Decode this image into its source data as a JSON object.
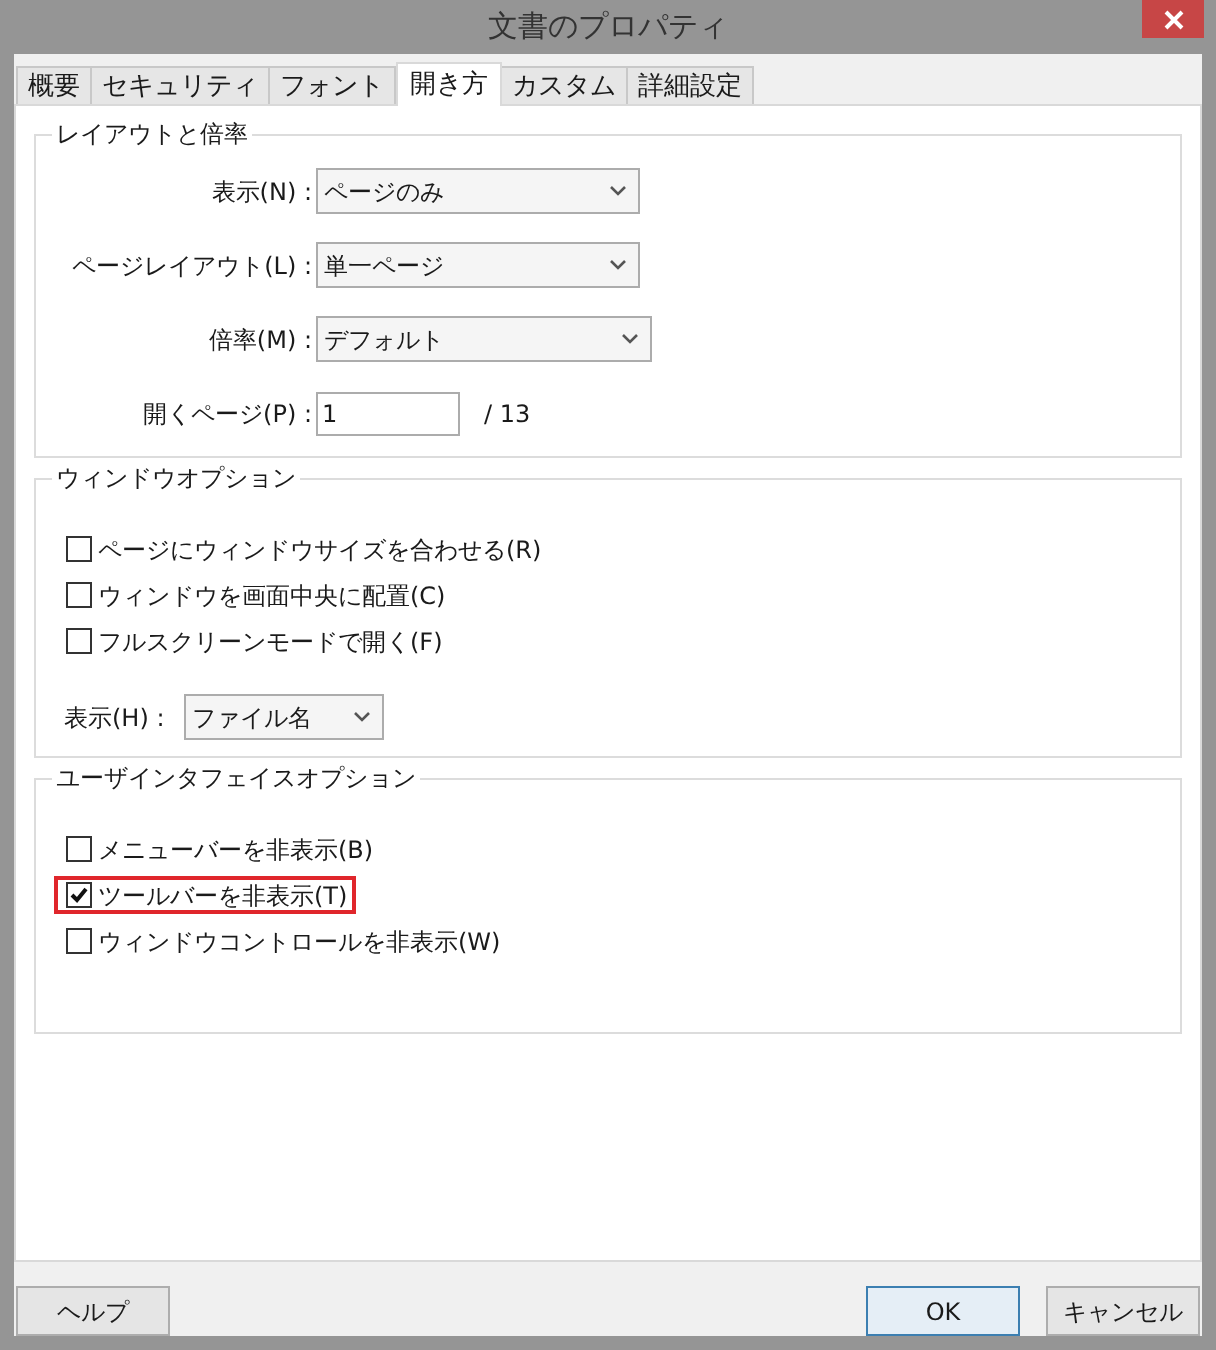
{
  "window": {
    "title": "文書のプロパティ"
  },
  "tabs": [
    {
      "label": "概要",
      "selected": false
    },
    {
      "label": "セキュリティ",
      "selected": false
    },
    {
      "label": "フォント",
      "selected": false
    },
    {
      "label": "開き方",
      "selected": true
    },
    {
      "label": "カスタム",
      "selected": false
    },
    {
      "label": "詳細設定",
      "selected": false
    }
  ],
  "layout_group": {
    "title": "レイアウトと倍率",
    "fields": [
      {
        "kind": "dropdown",
        "label": "表示(N) :",
        "value": "ページのみ"
      },
      {
        "kind": "dropdown",
        "label": "ページレイアウト(L) :",
        "value": "単一ページ"
      },
      {
        "kind": "dropdown",
        "label": "倍率(M) :",
        "value": "デフォルト"
      },
      {
        "kind": "text",
        "label": "開くページ(P) :",
        "value": "1",
        "suffix": "/ 13"
      }
    ]
  },
  "window_options": {
    "title": "ウィンドウオプション",
    "checkboxes": [
      {
        "label": "ページにウィンドウサイズを合わせる(R)",
        "checked": false,
        "highlighted": false
      },
      {
        "label": "ウィンドウを画面中央に配置(C)",
        "checked": false,
        "highlighted": false
      },
      {
        "label": "フルスクリーンモードで開く(F)",
        "checked": false,
        "highlighted": false
      }
    ],
    "display_field": {
      "label": "表示(H) :",
      "value": "ファイル名"
    }
  },
  "ui_options": {
    "title": "ユーザインタフェイスオプション",
    "checkboxes": [
      {
        "label": "メニューバーを非表示(B)",
        "checked": false,
        "highlighted": false
      },
      {
        "label": "ツールバーを非表示(T)",
        "checked": true,
        "highlighted": true
      },
      {
        "label": "ウィンドウコントロールを非表示(W)",
        "checked": false,
        "highlighted": false
      }
    ]
  },
  "buttons": [
    {
      "label": "ヘルプ",
      "default": false
    },
    {
      "label": "OK",
      "default": true
    },
    {
      "label": "キャンセル",
      "default": false
    }
  ]
}
